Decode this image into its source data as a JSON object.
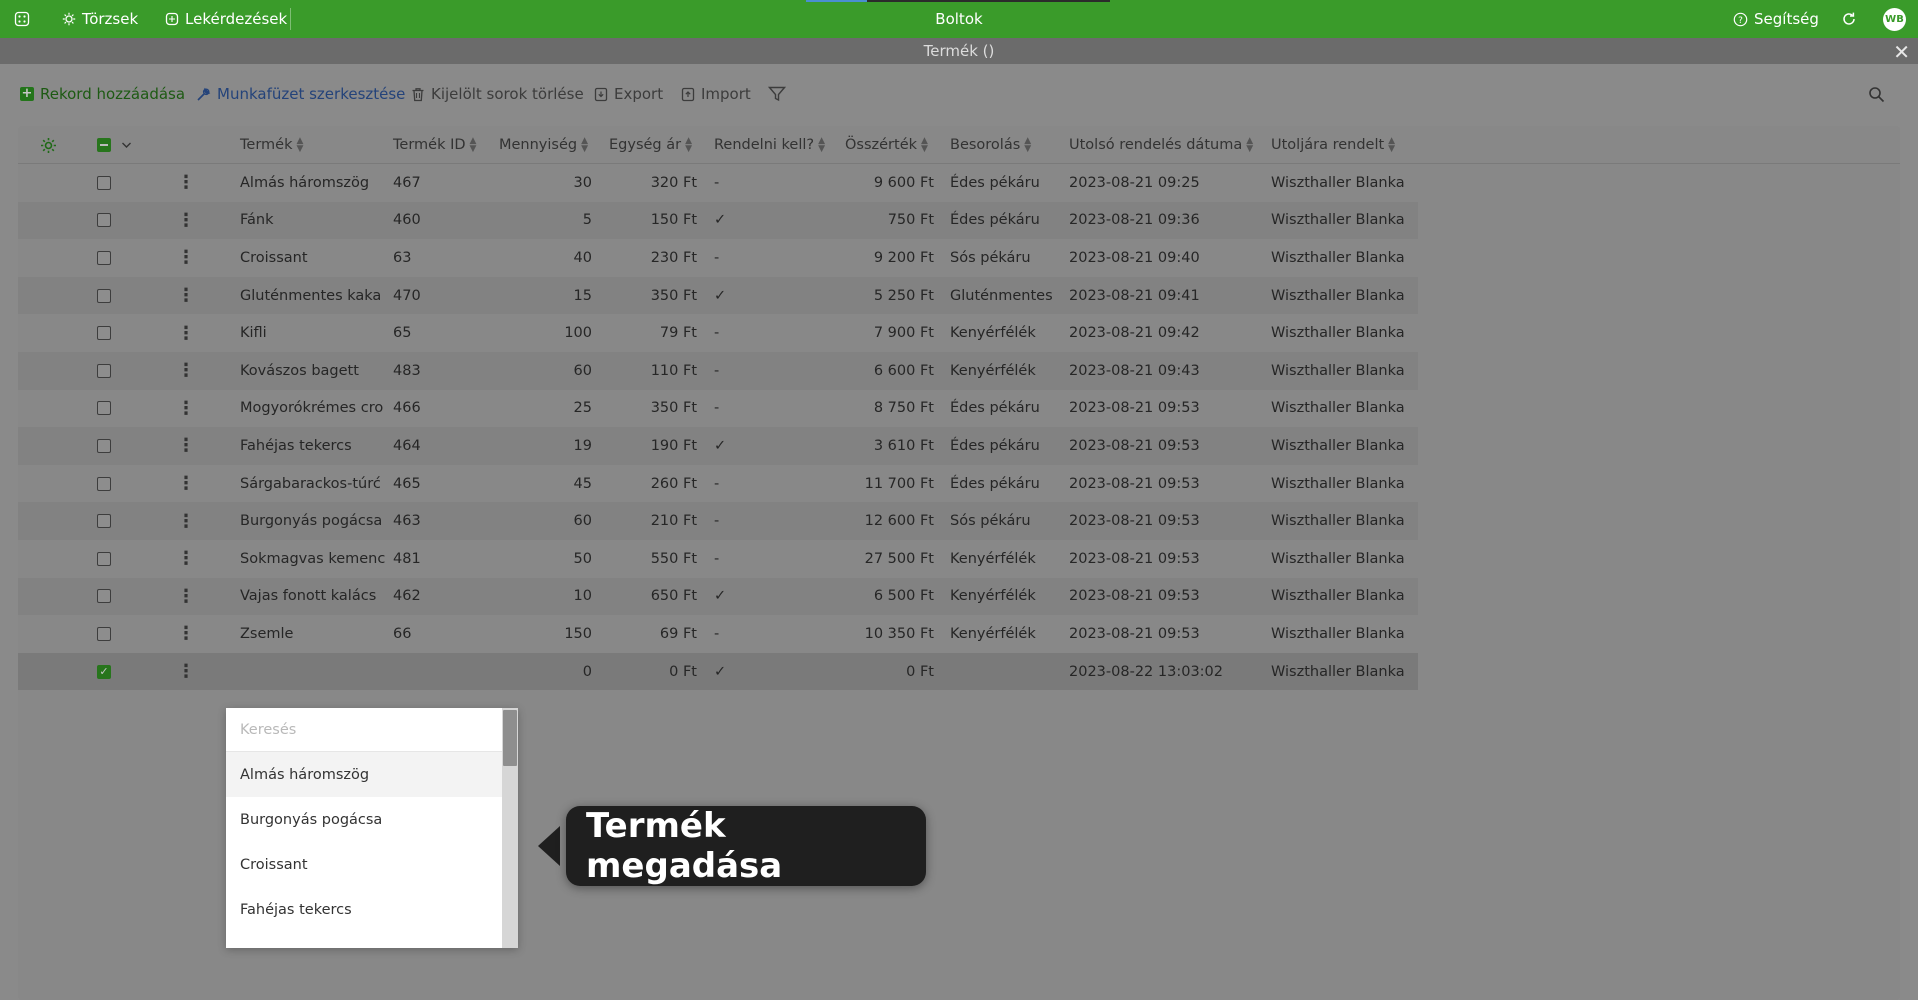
{
  "topbar": {
    "apps_icon": "grid-icon",
    "torzsek": "Törzsek",
    "lekerdezesek": "Lekérdezések",
    "title": "Boltok",
    "progress": 0.2,
    "help": "Segítség",
    "avatar": "WB",
    "color": "#3a9b2a"
  },
  "window": {
    "title": "Termék ()"
  },
  "toolbar": {
    "add": "Rekord hozzáadása",
    "edit_workbook": "Munkafüzet szerkesztése",
    "delete_selected": "Kijelölt sorok törlése",
    "export": "Export",
    "import": "Import"
  },
  "table": {
    "columns": [
      "Termék",
      "Termék ID",
      "Mennyiség",
      "Egység ár",
      "Rendelni kell?",
      "Összérték",
      "Besorolás",
      "Utolsó rendelés dátuma",
      "Utoljára rendelt"
    ],
    "rows": [
      {
        "termek": "Almás háromszög",
        "id": "467",
        "menny": "30",
        "ar": "320 Ft",
        "rendelni": "-",
        "ossz": "9 600 Ft",
        "besorolas": "Édes pékáru",
        "datum": "2023-08-21 09:25",
        "rendelt": "Wiszthaller Blanka"
      },
      {
        "termek": "Fánk",
        "id": "460",
        "menny": "5",
        "ar": "150 Ft",
        "rendelni": "✓",
        "ossz": "750 Ft",
        "besorolas": "Édes pékáru",
        "datum": "2023-08-21 09:36",
        "rendelt": "Wiszthaller Blanka"
      },
      {
        "termek": "Croissant",
        "id": "63",
        "menny": "40",
        "ar": "230 Ft",
        "rendelni": "-",
        "ossz": "9 200 Ft",
        "besorolas": "Sós pékáru",
        "datum": "2023-08-21 09:40",
        "rendelt": "Wiszthaller Blanka"
      },
      {
        "termek": "Gluténmentes kaka",
        "id": "470",
        "menny": "15",
        "ar": "350 Ft",
        "rendelni": "✓",
        "ossz": "5 250 Ft",
        "besorolas": "Gluténmentes",
        "datum": "2023-08-21 09:41",
        "rendelt": "Wiszthaller Blanka"
      },
      {
        "termek": "Kifli",
        "id": "65",
        "menny": "100",
        "ar": "79 Ft",
        "rendelni": "-",
        "ossz": "7 900 Ft",
        "besorolas": "Kenyérfélék",
        "datum": "2023-08-21 09:42",
        "rendelt": "Wiszthaller Blanka"
      },
      {
        "termek": "Kovászos bagett",
        "id": "483",
        "menny": "60",
        "ar": "110 Ft",
        "rendelni": "-",
        "ossz": "6 600 Ft",
        "besorolas": "Kenyérfélék",
        "datum": "2023-08-21 09:43",
        "rendelt": "Wiszthaller Blanka"
      },
      {
        "termek": "Mogyorókrémes cro",
        "id": "466",
        "menny": "25",
        "ar": "350 Ft",
        "rendelni": "-",
        "ossz": "8 750 Ft",
        "besorolas": "Édes pékáru",
        "datum": "2023-08-21 09:53",
        "rendelt": "Wiszthaller Blanka"
      },
      {
        "termek": "Fahéjas tekercs",
        "id": "464",
        "menny": "19",
        "ar": "190 Ft",
        "rendelni": "✓",
        "ossz": "3 610 Ft",
        "besorolas": "Édes pékáru",
        "datum": "2023-08-21 09:53",
        "rendelt": "Wiszthaller Blanka"
      },
      {
        "termek": "Sárgabarackos-túrć",
        "id": "465",
        "menny": "45",
        "ar": "260 Ft",
        "rendelni": "-",
        "ossz": "11 700 Ft",
        "besorolas": "Édes pékáru",
        "datum": "2023-08-21 09:53",
        "rendelt": "Wiszthaller Blanka"
      },
      {
        "termek": "Burgonyás pogácsa",
        "id": "463",
        "menny": "60",
        "ar": "210 Ft",
        "rendelni": "-",
        "ossz": "12 600 Ft",
        "besorolas": "Sós pékáru",
        "datum": "2023-08-21 09:53",
        "rendelt": "Wiszthaller Blanka"
      },
      {
        "termek": "Sokmagvas kemenc",
        "id": "481",
        "menny": "50",
        "ar": "550 Ft",
        "rendelni": "-",
        "ossz": "27 500 Ft",
        "besorolas": "Kenyérfélék",
        "datum": "2023-08-21 09:53",
        "rendelt": "Wiszthaller Blanka"
      },
      {
        "termek": "Vajas fonott kalács",
        "id": "462",
        "menny": "10",
        "ar": "650 Ft",
        "rendelni": "✓",
        "ossz": "6 500 Ft",
        "besorolas": "Kenyérfélék",
        "datum": "2023-08-21 09:53",
        "rendelt": "Wiszthaller Blanka"
      },
      {
        "termek": "Zsemle",
        "id": "66",
        "menny": "150",
        "ar": "69 Ft",
        "rendelni": "-",
        "ossz": "10 350 Ft",
        "besorolas": "Kenyérfélék",
        "datum": "2023-08-21 09:53",
        "rendelt": "Wiszthaller Blanka"
      },
      {
        "termek": "",
        "id": "",
        "menny": "0",
        "ar": "0 Ft",
        "rendelni": "✓",
        "ossz": "0 Ft",
        "besorolas": "",
        "datum": "2023-08-22 13:03:02",
        "rendelt": "Wiszthaller Blanka"
      }
    ]
  },
  "dropdown": {
    "placeholder": "Keresés",
    "options": [
      "Almás háromszög",
      "Burgonyás pogácsa",
      "Croissant",
      "Fahéjas tekercs"
    ]
  },
  "callout": {
    "text": "Termék megadása"
  }
}
